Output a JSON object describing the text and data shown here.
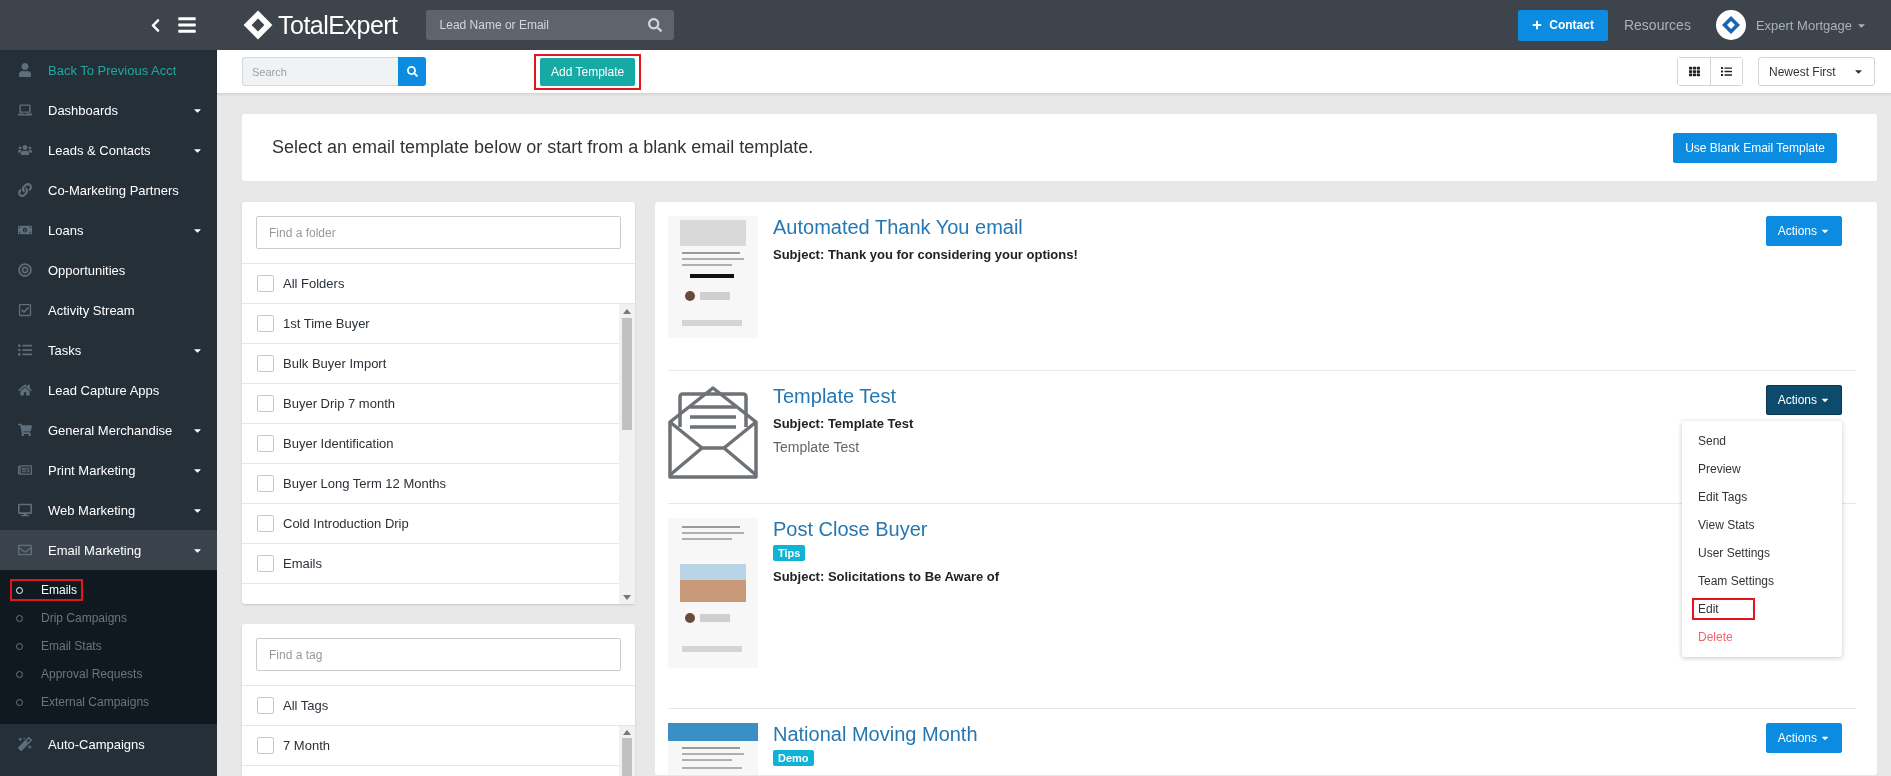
{
  "header": {
    "logo": "TotalExpert",
    "search": {
      "placeholder": "Lead Name or Email"
    },
    "contact_button": "Contact",
    "resources_link": "Resources",
    "account": "Expert Mortgage"
  },
  "sidebar": {
    "back_link": "Back To Previous Acct",
    "items": [
      {
        "label": "Dashboards",
        "expandable": true,
        "expanded": false
      },
      {
        "label": "Leads & Contacts",
        "expandable": true,
        "expanded": false
      },
      {
        "label": "Co-Marketing Partners",
        "expandable": false,
        "expanded": false
      },
      {
        "label": "Loans",
        "expandable": true,
        "expanded": false
      },
      {
        "label": "Opportunities",
        "expandable": false,
        "expanded": false
      },
      {
        "label": "Activity Stream",
        "expandable": false,
        "expanded": false
      },
      {
        "label": "Tasks",
        "expandable": true,
        "expanded": false
      },
      {
        "label": "Lead Capture Apps",
        "expandable": false,
        "expanded": false
      },
      {
        "label": "General Merchandise",
        "expandable": true,
        "expanded": false
      },
      {
        "label": "Print Marketing",
        "expandable": true,
        "expanded": false
      },
      {
        "label": "Web Marketing",
        "expandable": true,
        "expanded": false
      },
      {
        "label": "Email Marketing",
        "expandable": true,
        "expanded": true,
        "children": [
          {
            "label": "Emails",
            "selected": true,
            "highlighted": true
          },
          {
            "label": "Drip Campaigns",
            "selected": false,
            "highlighted": false
          },
          {
            "label": "Email Stats",
            "selected": false,
            "highlighted": false
          },
          {
            "label": "Approval Requests",
            "selected": false,
            "highlighted": false
          },
          {
            "label": "External Campaigns",
            "selected": false,
            "highlighted": false
          }
        ]
      },
      {
        "label": "Auto-Campaigns",
        "expandable": false,
        "expanded": false
      }
    ]
  },
  "toolbar": {
    "search": {
      "placeholder": "Search"
    },
    "add_button": {
      "label": "Add Template",
      "highlighted": true
    },
    "sort": "Newest First"
  },
  "banner": {
    "text": "Select an email template below or start from a blank email template.",
    "button": "Use Blank Email Template"
  },
  "folders": {
    "search": {
      "placeholder": "Find a folder"
    },
    "all": {
      "label": "All Folders",
      "checked": false
    },
    "items": [
      {
        "label": "1st Time Buyer",
        "checked": false
      },
      {
        "label": "Bulk Buyer Import",
        "checked": false
      },
      {
        "label": "Buyer Drip 7 month",
        "checked": false
      },
      {
        "label": "Buyer Identification",
        "checked": false
      },
      {
        "label": "Buyer Long Term 12 Months",
        "checked": false
      },
      {
        "label": "Cold Introduction Drip",
        "checked": false
      },
      {
        "label": "Emails",
        "checked": false
      }
    ]
  },
  "tags": {
    "search": {
      "placeholder": "Find a tag"
    },
    "all": {
      "label": "All Tags",
      "checked": false
    },
    "items": [
      {
        "label": "7 Month",
        "checked": false
      }
    ]
  },
  "templates": [
    {
      "title": "Automated Thank You email",
      "kind": "picture",
      "subject": "Subject: Thank you for considering your options!",
      "actions": {
        "label": "Actions",
        "open": false
      }
    },
    {
      "title": "Template Test",
      "kind": "envelope",
      "subject": "Subject: Template Test",
      "description": "Template Test",
      "actions": {
        "label": "Actions",
        "open": true,
        "menu": [
          {
            "label": "Send",
            "kind": "normal",
            "highlighted": false
          },
          {
            "label": "Preview",
            "kind": "normal",
            "highlighted": false
          },
          {
            "label": "Edit Tags",
            "kind": "normal",
            "highlighted": false
          },
          {
            "label": "View Stats",
            "kind": "normal",
            "highlighted": false
          },
          {
            "label": "User Settings",
            "kind": "normal",
            "highlighted": false
          },
          {
            "label": "Team Settings",
            "kind": "normal",
            "highlighted": false
          },
          {
            "label": "Edit",
            "kind": "normal",
            "highlighted": true
          },
          {
            "label": "Delete",
            "kind": "danger",
            "highlighted": false
          }
        ]
      }
    },
    {
      "title": "Post Close Buyer",
      "kind": "picture",
      "tag": "Tips",
      "subject": "Subject: Solicitations to Be Aware of"
    },
    {
      "title": "National Moving Month",
      "kind": "picture",
      "tag": "Demo",
      "actions": {
        "label": "Actions",
        "open": false
      }
    }
  ]
}
